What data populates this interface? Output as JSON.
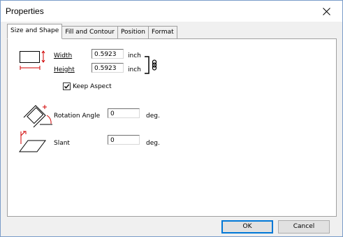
{
  "window": {
    "title": "Properties"
  },
  "tabs": [
    {
      "label": "Size and Shape"
    },
    {
      "label": "Fill and Contour"
    },
    {
      "label": "Position"
    },
    {
      "label": "Format"
    }
  ],
  "size": {
    "width_label": "Width",
    "width_value": "0.5923",
    "width_unit": "inch",
    "height_label": "Height",
    "height_value": "0.5923",
    "height_unit": "inch",
    "keep_aspect_label": "Keep Aspect",
    "keep_aspect_checked": true
  },
  "rotation": {
    "label": "Rotation Angle",
    "value": "0",
    "unit": "deg."
  },
  "slant": {
    "label": "Slant",
    "value": "0",
    "unit": "deg."
  },
  "buttons": {
    "ok": "OK",
    "cancel": "Cancel"
  }
}
